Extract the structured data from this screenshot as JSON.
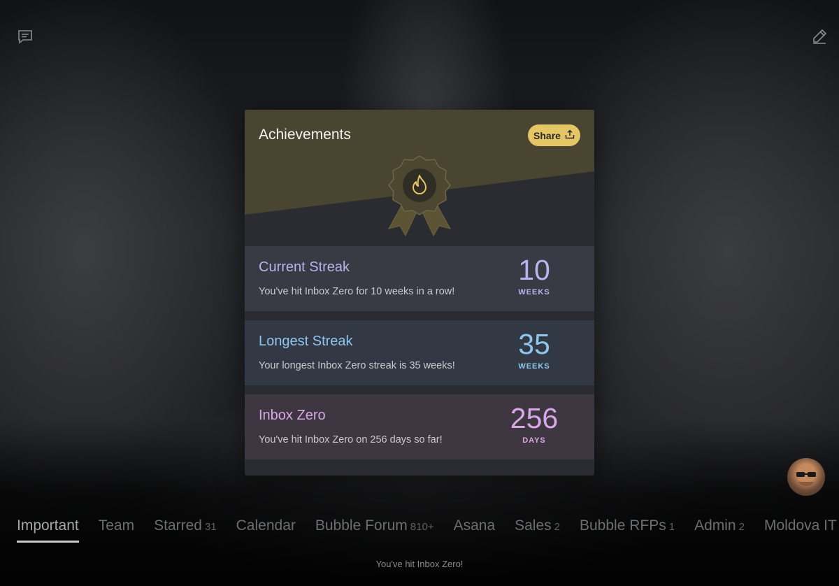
{
  "top_bar": {
    "left_icon": "chat-bubble-icon",
    "right_icon": "compose-pencil-icon"
  },
  "achievements": {
    "title": "Achievements",
    "share_label": "Share",
    "share_icon": "share-upload-icon",
    "badge_icon": "flame-ribbon-badge-icon",
    "rows": [
      {
        "title": "Current Streak",
        "description": "You've hit Inbox Zero for 10 weeks in a row!",
        "value": "10",
        "unit": "WEEKS"
      },
      {
        "title": "Longest Streak",
        "description": "Your longest Inbox Zero streak is 35 weeks!",
        "value": "35",
        "unit": "WEEKS"
      },
      {
        "title": "Inbox Zero",
        "description": "You've hit Inbox Zero on 256 days so far!",
        "value": "256",
        "unit": "DAYS"
      }
    ]
  },
  "colors": {
    "accent_gold": "#e5c667",
    "current_streak": "#b6b5ec",
    "longest_streak": "#8fc6ee",
    "inbox_zero": "#d9a8e6"
  },
  "tabs": [
    {
      "label": "Important",
      "count": ""
    },
    {
      "label": "Team",
      "count": ""
    },
    {
      "label": "Starred",
      "count": "31"
    },
    {
      "label": "Calendar",
      "count": ""
    },
    {
      "label": "Bubble Forum",
      "count": "810+"
    },
    {
      "label": "Asana",
      "count": ""
    },
    {
      "label": "Sales",
      "count": "2"
    },
    {
      "label": "Bubble RFPs",
      "count": "1"
    },
    {
      "label": "Admin",
      "count": "2"
    },
    {
      "label": "Moldova IT Park",
      "count": ""
    }
  ],
  "status_text": "You've hit Inbox Zero!"
}
